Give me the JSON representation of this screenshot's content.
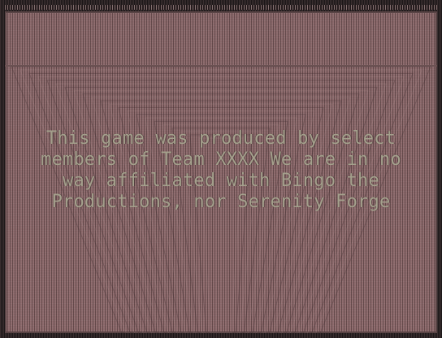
{
  "screen": {
    "lines": [
      "This game was produced by select",
      "members of Team XXXX We are in no",
      "way affiliated with Bingo the",
      "Productions, nor Serenity Forge"
    ]
  },
  "colors": {
    "background": "#8d6b6d",
    "text": "#a7a48f",
    "frame": "#1c1718"
  }
}
